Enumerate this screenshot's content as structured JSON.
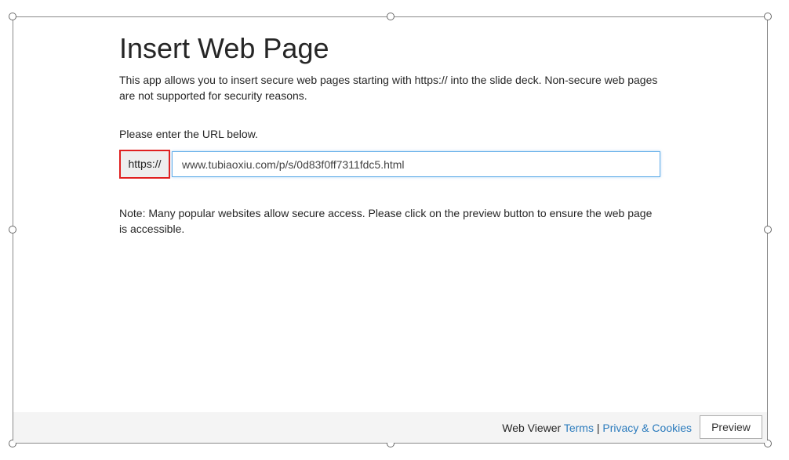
{
  "page": {
    "title": "Insert Web Page",
    "intro": "This app allows you to insert secure web pages starting with https:// into the slide deck. Non-secure web pages are not supported for security reasons.",
    "prompt": "Please enter the URL below.",
    "url_prefix": "https://",
    "url_value": "www.tubiaoxiu.com/p/s/0d83f0ff7311fdc5.html",
    "note": "Note: Many popular websites allow secure access. Please click on the preview button to ensure the web page is accessible."
  },
  "footer": {
    "brand": "Web Viewer",
    "terms_label": "Terms",
    "separator": "|",
    "privacy_label": "Privacy & Cookies",
    "preview_label": "Preview"
  },
  "colors": {
    "link": "#2b7bbd",
    "prefix_highlight": "#e02020",
    "input_focus": "#66afe9"
  }
}
